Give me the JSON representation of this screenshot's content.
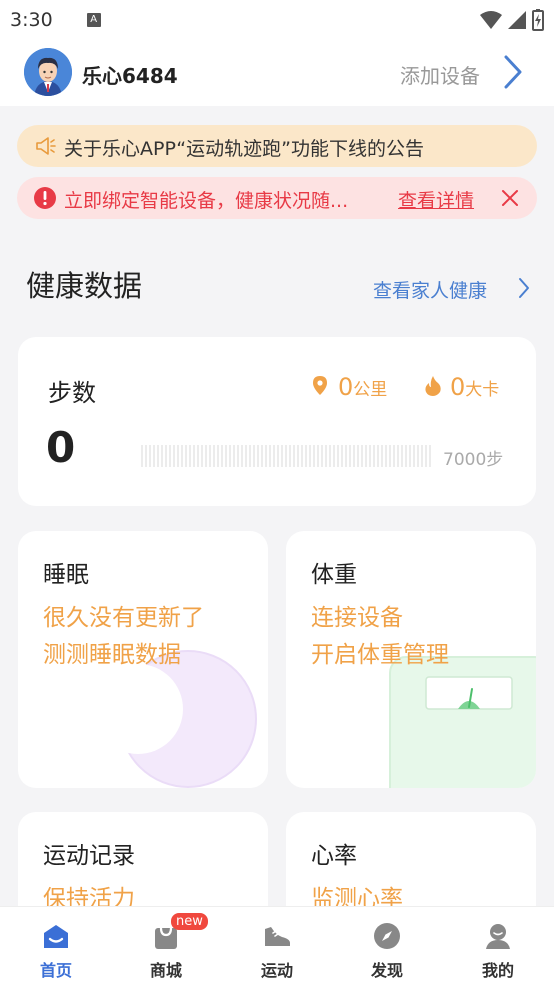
{
  "status_bar": {
    "time": "3:30",
    "a_icon_label": "A"
  },
  "header": {
    "user_name": "乐心6484",
    "add_device_label": "添加设备"
  },
  "notices": {
    "announcement": "关于乐心APP“运动轨迹跑”功能下线的公告",
    "bind_prompt": "立即绑定智能设备，健康状况随...",
    "details_link": "查看详情"
  },
  "health": {
    "title": "健康数据",
    "family_link": "查看家人健康"
  },
  "steps": {
    "label": "步数",
    "value": "0",
    "distance_value": "0",
    "distance_unit": "公里",
    "calories_value": "0",
    "calories_unit": "大卡",
    "goal_label": "7000步",
    "progress_fraction": 0
  },
  "sleep": {
    "title": "睡眠",
    "line1": "很久没有更新了",
    "line2": "测测睡眠数据"
  },
  "weight": {
    "title": "体重",
    "line1": "连接设备",
    "line2": "开启体重管理"
  },
  "sport_record": {
    "title": "运动记录",
    "line1": "保持活力"
  },
  "heart_rate": {
    "title": "心率",
    "line1": "监测心率"
  },
  "nav": {
    "home": "首页",
    "mall": "商城",
    "mall_badge": "new",
    "sport": "运动",
    "discover": "发现",
    "mine": "我的"
  },
  "colors": {
    "accent_blue": "#3b6fd6",
    "orange": "#f0a248",
    "alert_red": "#e83a46",
    "notice_yellow": "#fbe7c9",
    "notice_pink": "#fde2e2"
  }
}
